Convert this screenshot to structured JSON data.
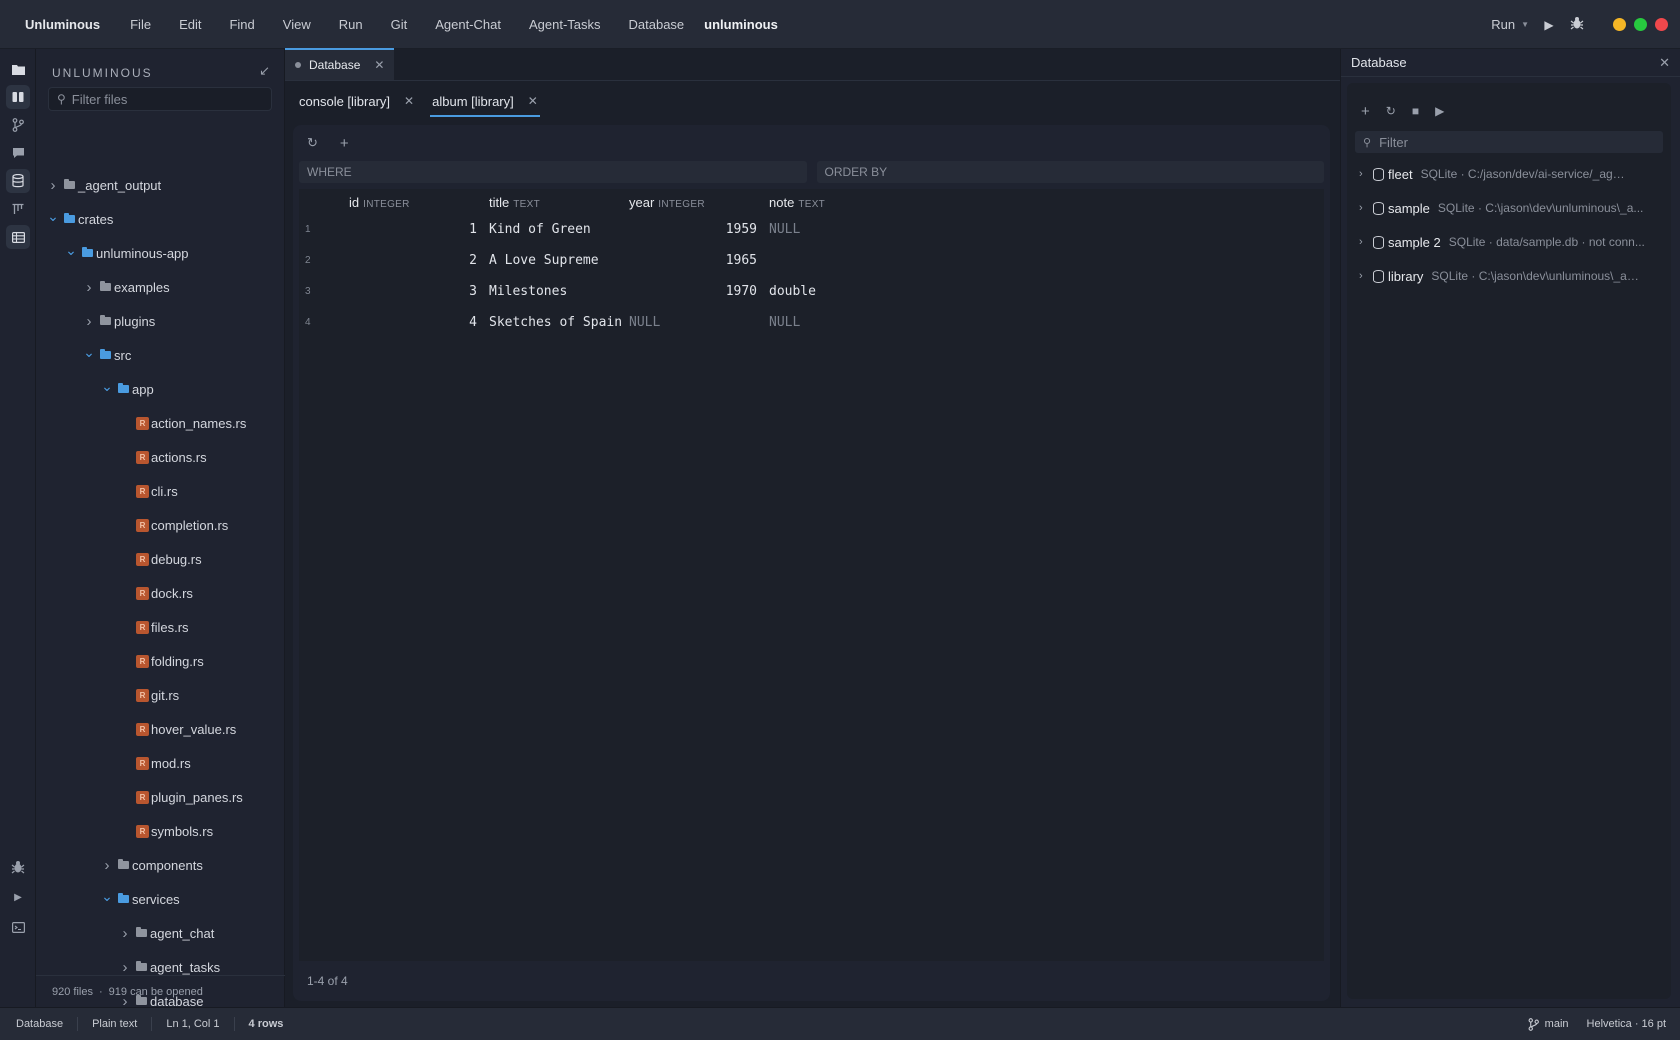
{
  "titlebar": {
    "app_name": "Unluminous",
    "menu": [
      "File",
      "Edit",
      "Find",
      "View",
      "Run",
      "Git",
      "Agent-Chat",
      "Agent-Tasks",
      "Database"
    ],
    "project": "unluminous",
    "run_label": "Run",
    "traffic_colors": [
      "#f5b626",
      "#27c93f",
      "#f0484c"
    ]
  },
  "explorer": {
    "title": "UNLUMINOUS",
    "filter_placeholder": "Filter files",
    "footer_files": "920 files",
    "footer_opened": "919 can be opened",
    "tree": [
      {
        "label": "_agent_output",
        "kind": "folder",
        "depth": 0,
        "expanded": false
      },
      {
        "label": "crates",
        "kind": "folder",
        "depth": 0,
        "expanded": true
      },
      {
        "label": "unluminous-app",
        "kind": "folder",
        "depth": 1,
        "expanded": true
      },
      {
        "label": "examples",
        "kind": "folder",
        "depth": 2,
        "expanded": false
      },
      {
        "label": "plugins",
        "kind": "folder",
        "depth": 2,
        "expanded": false
      },
      {
        "label": "src",
        "kind": "folder",
        "depth": 2,
        "expanded": true
      },
      {
        "label": "app",
        "kind": "folder",
        "depth": 3,
        "expanded": true
      },
      {
        "label": "action_names.rs",
        "kind": "rust",
        "depth": 4
      },
      {
        "label": "actions.rs",
        "kind": "rust",
        "depth": 4
      },
      {
        "label": "cli.rs",
        "kind": "rust",
        "depth": 4
      },
      {
        "label": "completion.rs",
        "kind": "rust",
        "depth": 4
      },
      {
        "label": "debug.rs",
        "kind": "rust",
        "depth": 4
      },
      {
        "label": "dock.rs",
        "kind": "rust",
        "depth": 4
      },
      {
        "label": "files.rs",
        "kind": "rust",
        "depth": 4
      },
      {
        "label": "folding.rs",
        "kind": "rust",
        "depth": 4
      },
      {
        "label": "git.rs",
        "kind": "rust",
        "depth": 4
      },
      {
        "label": "hover_value.rs",
        "kind": "rust",
        "depth": 4
      },
      {
        "label": "mod.rs",
        "kind": "rust",
        "depth": 4
      },
      {
        "label": "plugin_panes.rs",
        "kind": "rust",
        "depth": 4
      },
      {
        "label": "symbols.rs",
        "kind": "rust",
        "depth": 4
      },
      {
        "label": "components",
        "kind": "folder",
        "depth": 3,
        "expanded": false
      },
      {
        "label": "services",
        "kind": "folder",
        "depth": 3,
        "expanded": true
      },
      {
        "label": "agent_chat",
        "kind": "folder",
        "depth": 4,
        "expanded": false
      },
      {
        "label": "agent_tasks",
        "kind": "folder",
        "depth": 4,
        "expanded": false
      },
      {
        "label": "database",
        "kind": "folder",
        "depth": 4,
        "expanded": false
      }
    ]
  },
  "editor": {
    "main_tab": "Database",
    "subtabs": [
      {
        "label": "console [library]",
        "active": false
      },
      {
        "label": "album [library]",
        "active": true
      }
    ],
    "where_placeholder": "WHERE",
    "orderby_placeholder": "ORDER BY",
    "columns": [
      {
        "name": "id",
        "type": "INTEGER"
      },
      {
        "name": "title",
        "type": "TEXT"
      },
      {
        "name": "year",
        "type": "INTEGER"
      },
      {
        "name": "note",
        "type": "TEXT"
      }
    ],
    "rows": [
      {
        "n": "1",
        "id": "1",
        "title": "Kind of Green",
        "year": "1959",
        "note": "NULL"
      },
      {
        "n": "2",
        "id": "2",
        "title": "A Love Supreme",
        "year": "1965",
        "note": ""
      },
      {
        "n": "3",
        "id": "3",
        "title": "Milestones",
        "year": "1970",
        "note": "double"
      },
      {
        "n": "4",
        "id": "4",
        "title": "Sketches of Spain",
        "year": "NULL",
        "note": "NULL"
      }
    ],
    "footer": "1-4 of 4"
  },
  "database_panel": {
    "title": "Database",
    "filter_placeholder": "Filter",
    "connections": [
      {
        "name": "fleet",
        "meta": "SQLite · C:/jason/dev/ai-service/_agent_..."
      },
      {
        "name": "sample",
        "meta": "SQLite · C:\\jason\\dev\\unluminous\\_a..."
      },
      {
        "name": "sample 2",
        "meta": "SQLite · data/sample.db · not conn..."
      },
      {
        "name": "library",
        "meta": "SQLite · C:\\jason\\dev\\unluminous\\_ag..."
      }
    ]
  },
  "statusbar": {
    "mode": "Database",
    "language": "Plain text",
    "cursor": "Ln 1, Col 1",
    "rows": "4 rows",
    "branch": "main",
    "font": "Helvetica · 16 pt"
  }
}
